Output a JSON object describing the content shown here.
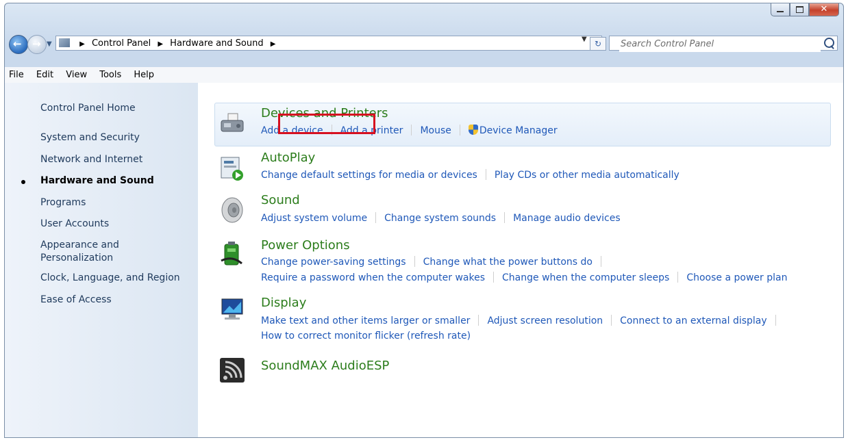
{
  "window": {
    "buttons": [
      "minimize",
      "maximize",
      "close"
    ]
  },
  "address": {
    "crumbs": [
      "Control Panel",
      "Hardware and Sound"
    ],
    "search_placeholder": "Search Control Panel"
  },
  "menu": [
    "File",
    "Edit",
    "View",
    "Tools",
    "Help"
  ],
  "sidebar": {
    "items": [
      {
        "label": "Control Panel Home"
      },
      {
        "label": "System and Security"
      },
      {
        "label": "Network and Internet"
      },
      {
        "label": "Hardware and Sound",
        "current": true
      },
      {
        "label": "Programs"
      },
      {
        "label": "User Accounts"
      },
      {
        "label": "Appearance and Personalization"
      },
      {
        "label": "Clock, Language, and Region"
      },
      {
        "label": "Ease of Access"
      }
    ]
  },
  "main": {
    "devices": {
      "title": "Devices and Printers",
      "links": [
        "Add a device",
        "Add a printer",
        "Mouse",
        "Device Manager"
      ]
    },
    "autoplay": {
      "title": "AutoPlay",
      "links": [
        "Change default settings for media or devices",
        "Play CDs or other media automatically"
      ]
    },
    "sound": {
      "title": "Sound",
      "links": [
        "Adjust system volume",
        "Change system sounds",
        "Manage audio devices"
      ]
    },
    "power": {
      "title": "Power Options",
      "links_row1": [
        "Change power-saving settings",
        "Change what the power buttons do"
      ],
      "links_row2": [
        "Require a password when the computer wakes",
        "Change when the computer sleeps",
        "Choose a power plan"
      ]
    },
    "display": {
      "title": "Display",
      "links_row1": [
        "Make text and other items larger or smaller",
        "Adjust screen resolution",
        "Connect to an external display"
      ],
      "links_row2": [
        "How to correct monitor flicker (refresh rate)"
      ]
    },
    "soundmax": {
      "title": "SoundMAX AudioESP"
    }
  },
  "colors": {
    "heading": "#2c7d1c",
    "link": "#1f58b8",
    "highlight": "#d61020"
  }
}
